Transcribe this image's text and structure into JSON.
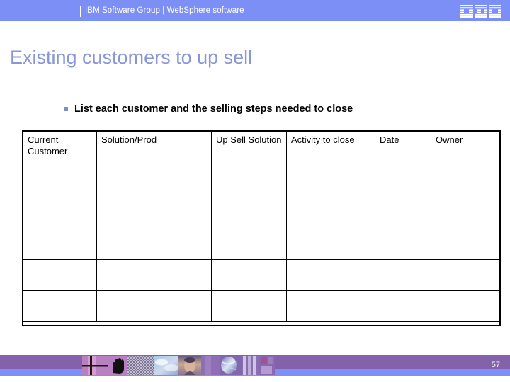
{
  "header": {
    "brand": "IBM Software Group | WebSphere software",
    "logo_alt": "IBM",
    "band_color": "#7b8ff7"
  },
  "slide": {
    "title": "Existing customers to up sell",
    "title_color": "#8895d9",
    "bullet": {
      "marker": "square-bullet",
      "text": "List each customer and the selling steps needed to close"
    }
  },
  "table": {
    "columns": [
      "Current Customer",
      "Solution/Prod",
      "Up Sell Solution",
      "Activity to close",
      "Date",
      "Owner"
    ],
    "rows": [
      [
        "",
        "",
        "",
        "",
        "",
        ""
      ],
      [
        "",
        "",
        "",
        "",
        "",
        ""
      ],
      [
        "",
        "",
        "",
        "",
        "",
        ""
      ],
      [
        "",
        "",
        "",
        "",
        "",
        ""
      ],
      [
        "",
        "",
        "",
        "",
        "",
        ""
      ]
    ]
  },
  "footer": {
    "page_number": "57",
    "band_color": "#8361ab",
    "accent_color": "#7b8ff7",
    "collage_alt": "decorative-image-strip"
  }
}
